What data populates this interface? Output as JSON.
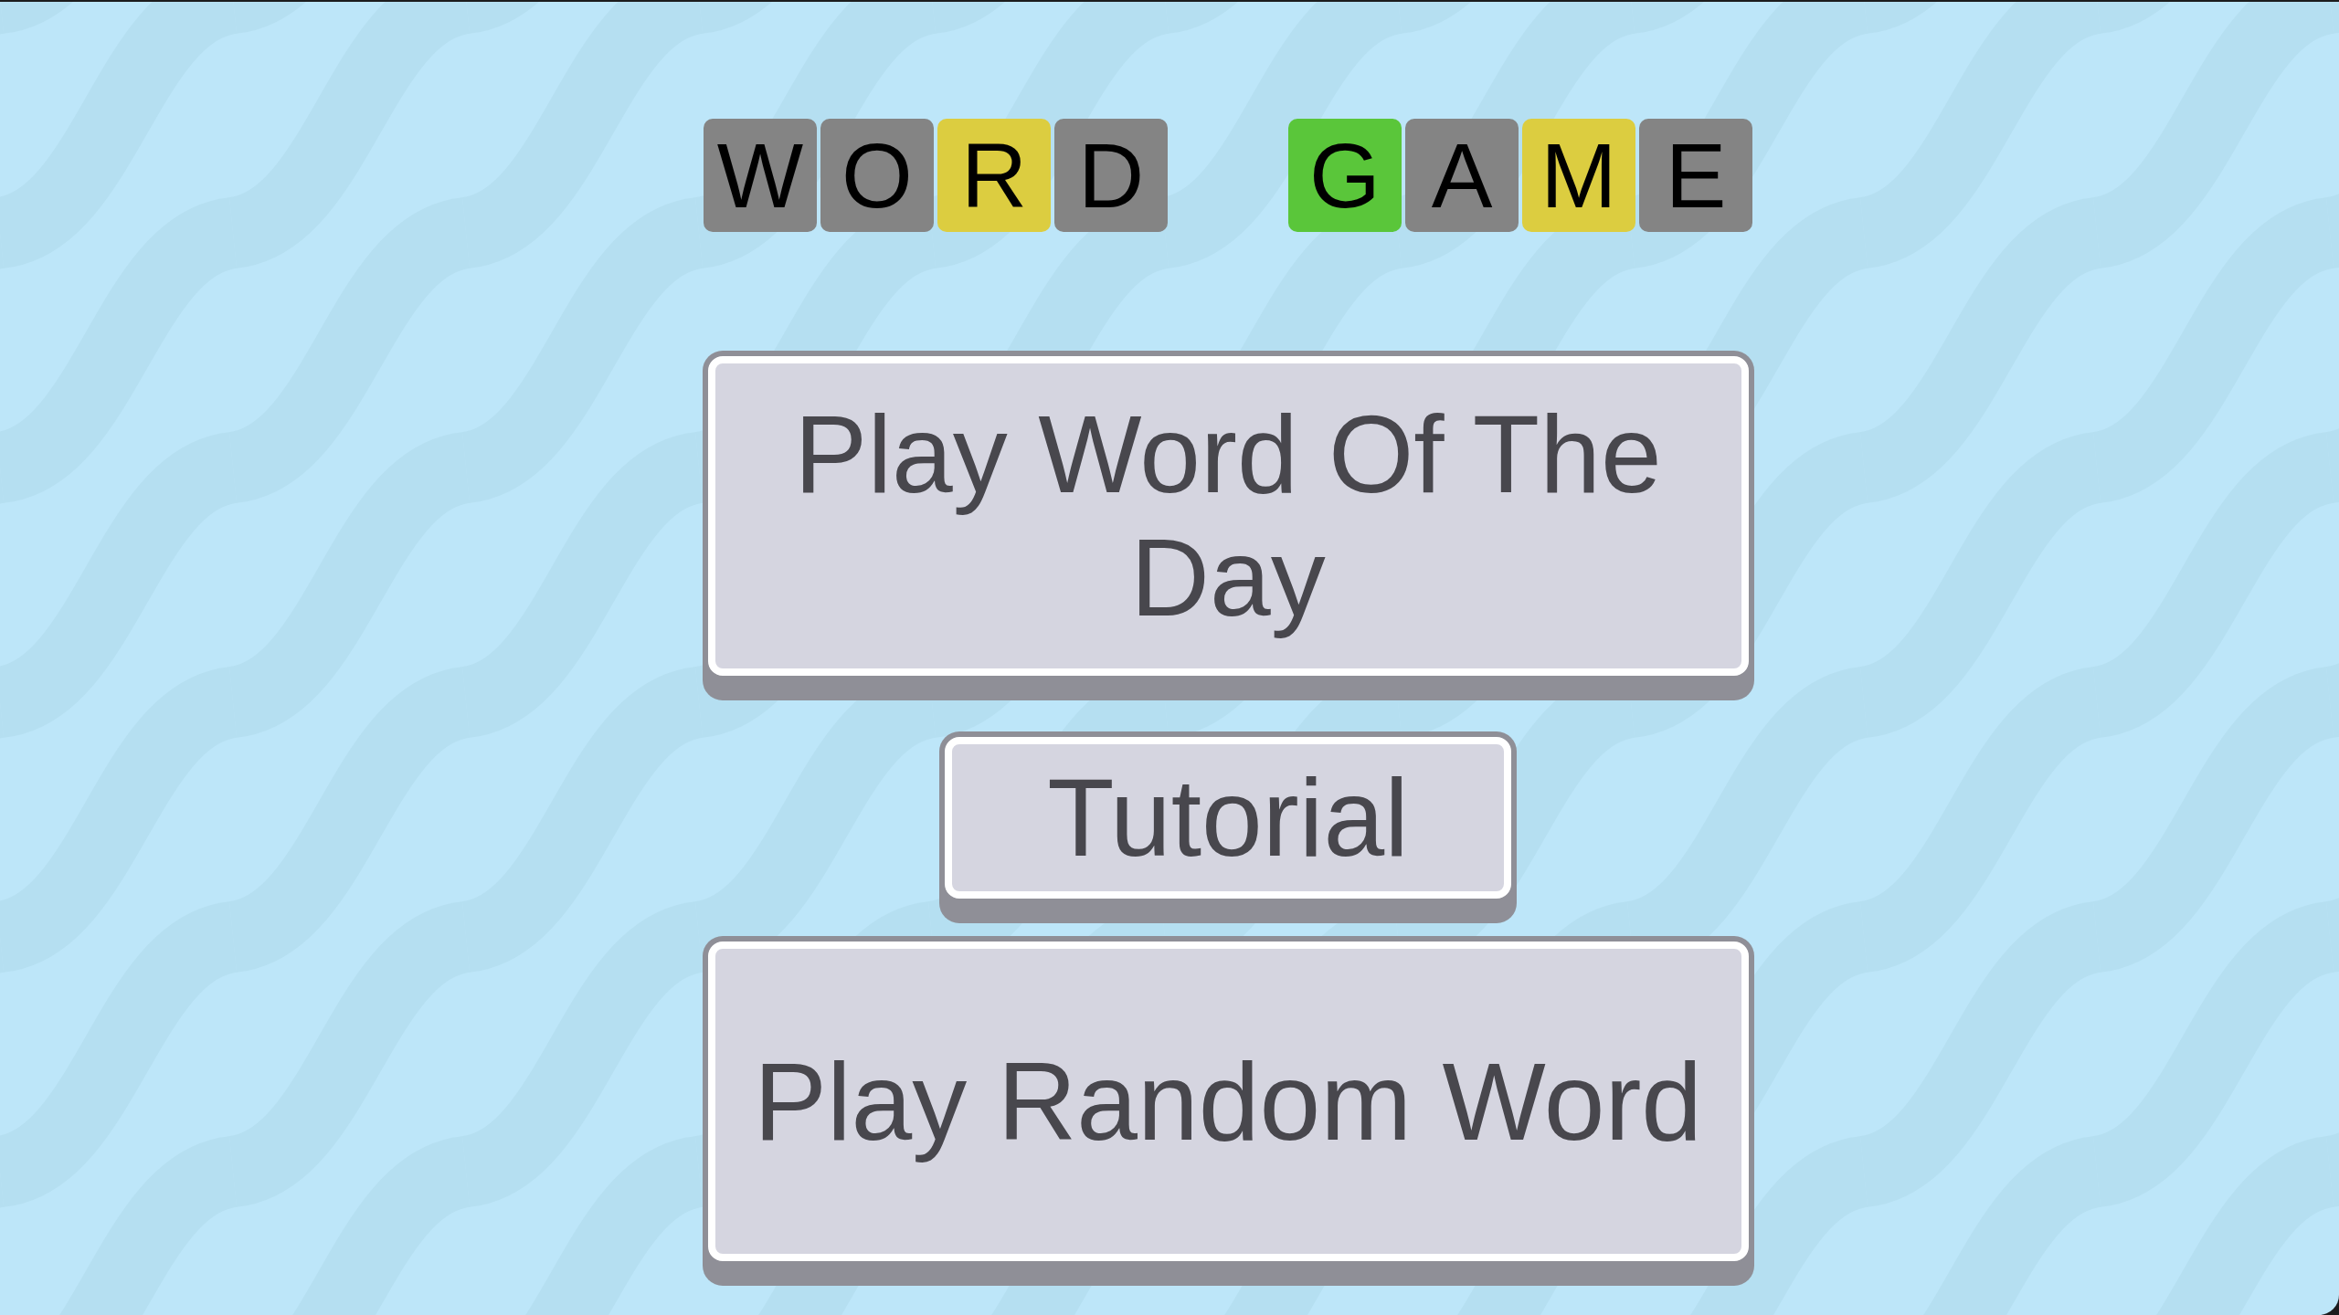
{
  "title": {
    "words": [
      {
        "tiles": [
          {
            "letter": "W",
            "color": "#848484"
          },
          {
            "letter": "O",
            "color": "#848484"
          },
          {
            "letter": "R",
            "color": "#dccd40"
          },
          {
            "letter": "D",
            "color": "#848484"
          }
        ]
      },
      {
        "tiles": [
          {
            "letter": "G",
            "color": "#5ac63a"
          },
          {
            "letter": "A",
            "color": "#848484"
          },
          {
            "letter": "M",
            "color": "#dccd40"
          },
          {
            "letter": "E",
            "color": "#848484"
          }
        ]
      }
    ]
  },
  "buttons": [
    {
      "label": "Play Word Of The Day",
      "kind": "wide"
    },
    {
      "label": "Tutorial",
      "kind": "compact"
    },
    {
      "label": "Play Random Word",
      "kind": "wide"
    }
  ]
}
